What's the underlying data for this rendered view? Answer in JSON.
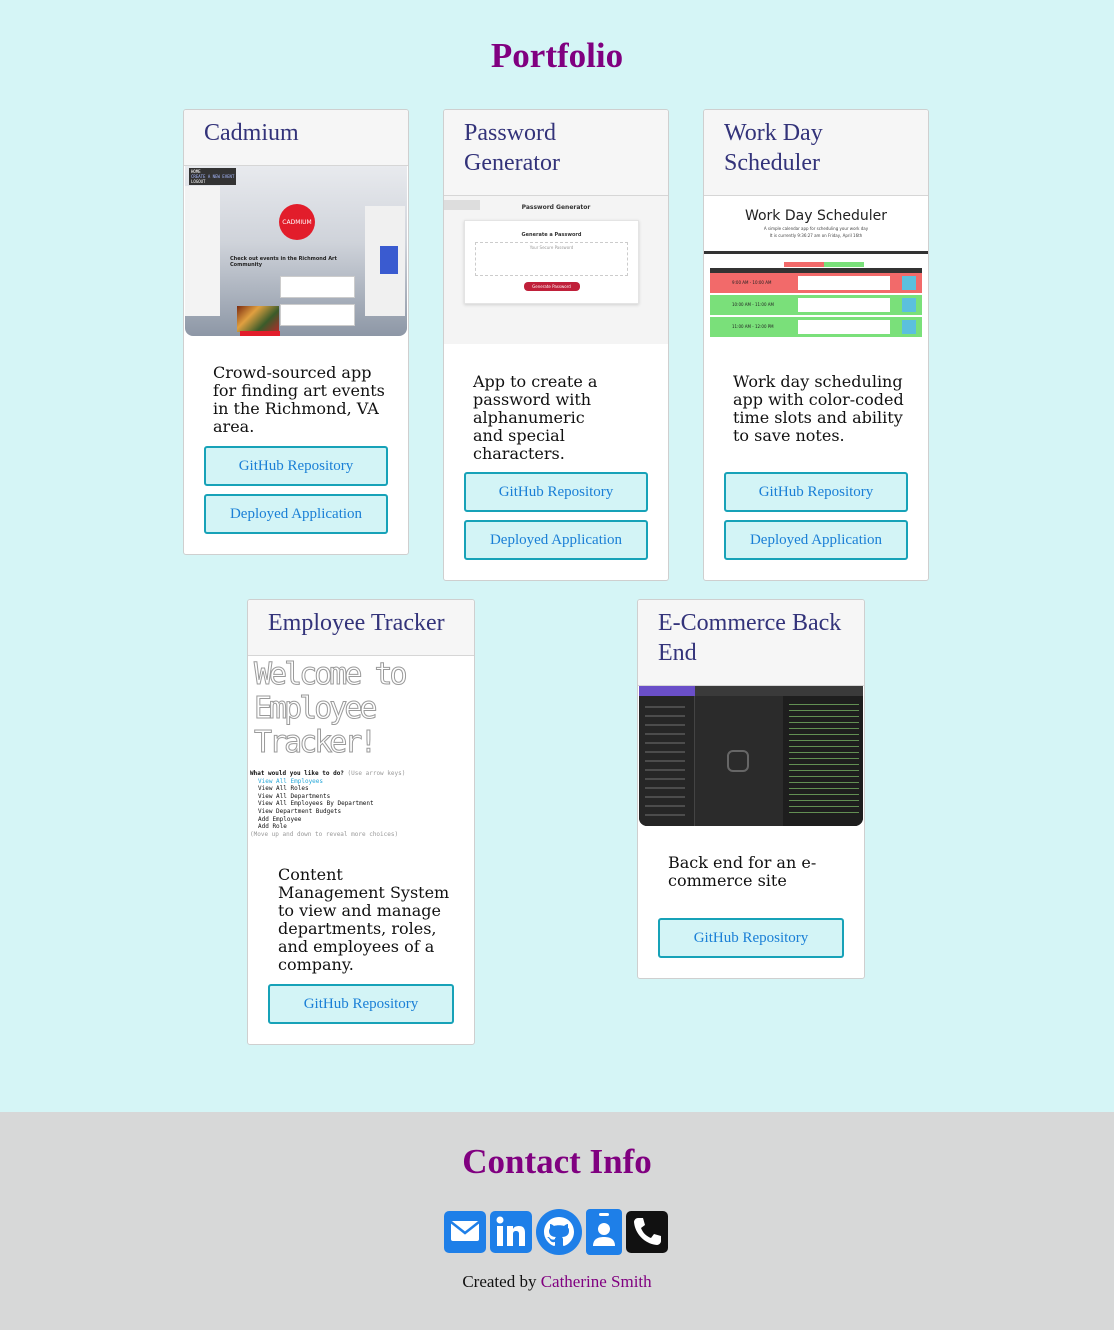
{
  "portfolio": {
    "title": "Portfolio",
    "projects": [
      {
        "title": "Cadmium",
        "description": "Crowd-sourced app for finding art events in the Richmond, VA area.",
        "buttons": [
          "GitHub Repository",
          "Deployed Application"
        ],
        "screenshot": {
          "nav_items": [
            "HOME",
            "CREATE A NEW EVENT",
            "LOGOUT"
          ],
          "logo": "CADMIUM",
          "tagline": "Check out events in the Richmond Art Community"
        }
      },
      {
        "title": "Password Generator",
        "description": "App to create a password with alphanumeric and special characters.",
        "buttons": [
          "GitHub Repository",
          "Deployed Application"
        ],
        "screenshot": {
          "heading": "Password Generator",
          "card_title": "Generate a Password",
          "placeholder": "Your Secure Password",
          "button": "Generate Password"
        }
      },
      {
        "title": "Work Day Scheduler",
        "description": "Work day scheduling app with color-coded time slots and ability to save notes.",
        "buttons": [
          "GitHub Repository",
          "Deployed Application"
        ],
        "screenshot": {
          "heading": "Work Day Scheduler",
          "subtitle": "A simple calendar app for scheduling your work day",
          "date_line": "It is currently 9:36:27 am on Friday, April 16th",
          "slots": [
            "9:00 AM - 10:00 AM",
            "10:00 AM - 11:00 AM",
            "11:00 AM - 12:00 PM"
          ]
        }
      },
      {
        "title": "Employee Tracker",
        "description": "Content Management System to view and manage departments, roles, and employees of a company.",
        "buttons": [
          "GitHub Repository"
        ],
        "screenshot": {
          "banner": [
            "Welcome to",
            "Employee",
            "Tracker!"
          ],
          "prompt": "What would you like to do?",
          "hint": "(Use arrow keys)",
          "options": [
            "View All Employees",
            "View All Roles",
            "View All Departments",
            "View All Employees By Department",
            "View Department Budgets",
            "Add Employee",
            "Add Role"
          ],
          "footer": "(Move up and down to reveal more choices)"
        }
      },
      {
        "title": "E-Commerce Back End",
        "description": "Back end for an e-commerce site",
        "buttons": [
          "GitHub Repository"
        ],
        "screenshot": {}
      }
    ]
  },
  "contact": {
    "title": "Contact Info",
    "icons": [
      "envelope-icon",
      "linkedin-icon",
      "github-icon",
      "contact-card-icon",
      "phone-icon"
    ],
    "created_prefix": "Created by",
    "author": "Catherine Smith"
  },
  "colors": {
    "accent": "#800080",
    "background": "#d5f5f6",
    "button_border": "#17a2b8",
    "icon_blue": "#1e7fe8"
  }
}
